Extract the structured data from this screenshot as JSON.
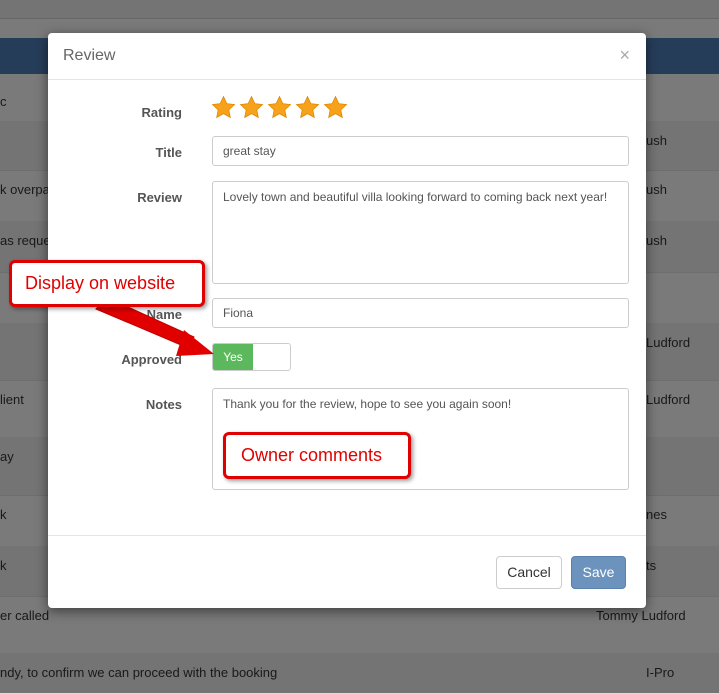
{
  "background": {
    "rows": [
      {
        "left": "c",
        "right": ""
      },
      {
        "left": "",
        "right": "ush"
      },
      {
        "left": "k overpa",
        "right": "ush"
      },
      {
        "left": "as reque",
        "right": "ush"
      },
      {
        "left": "",
        "right": ""
      },
      {
        "left": "",
        "right": "Ludford"
      },
      {
        "left": "lient",
        "right": "Ludford"
      },
      {
        "left": "ay",
        "right": ""
      },
      {
        "left": "k",
        "right": "nes"
      },
      {
        "left": "k",
        "right": "ts"
      },
      {
        "left": "er called",
        "right": "Tommy Ludford"
      },
      {
        "left": "ndy, to confirm we can proceed with the booking",
        "right": "I-Pro"
      }
    ]
  },
  "modal": {
    "title": "Review",
    "close": "×",
    "rating_label": "Rating",
    "rating_value": 5,
    "rating_max": 5,
    "title_label": "Title",
    "title_value": "great stay",
    "review_label": "Review",
    "review_value": "Lovely town and beautiful villa looking forward to coming back next year!",
    "name_label": "Name",
    "name_value": "Fiona",
    "approved_label": "Approved",
    "approved_value": "Yes",
    "notes_label": "Notes",
    "notes_value": "Thank you for the review, hope to see you again soon!",
    "cancel_label": "Cancel",
    "save_label": "Save"
  },
  "callouts": {
    "display_on_website": "Display on website",
    "owner_comments": "Owner comments"
  },
  "colors": {
    "header": "#4d7bb5",
    "toggle_on": "#5cb85c",
    "save": "#6b93bd",
    "callout": "#e00000",
    "star": "#f7a21b"
  }
}
